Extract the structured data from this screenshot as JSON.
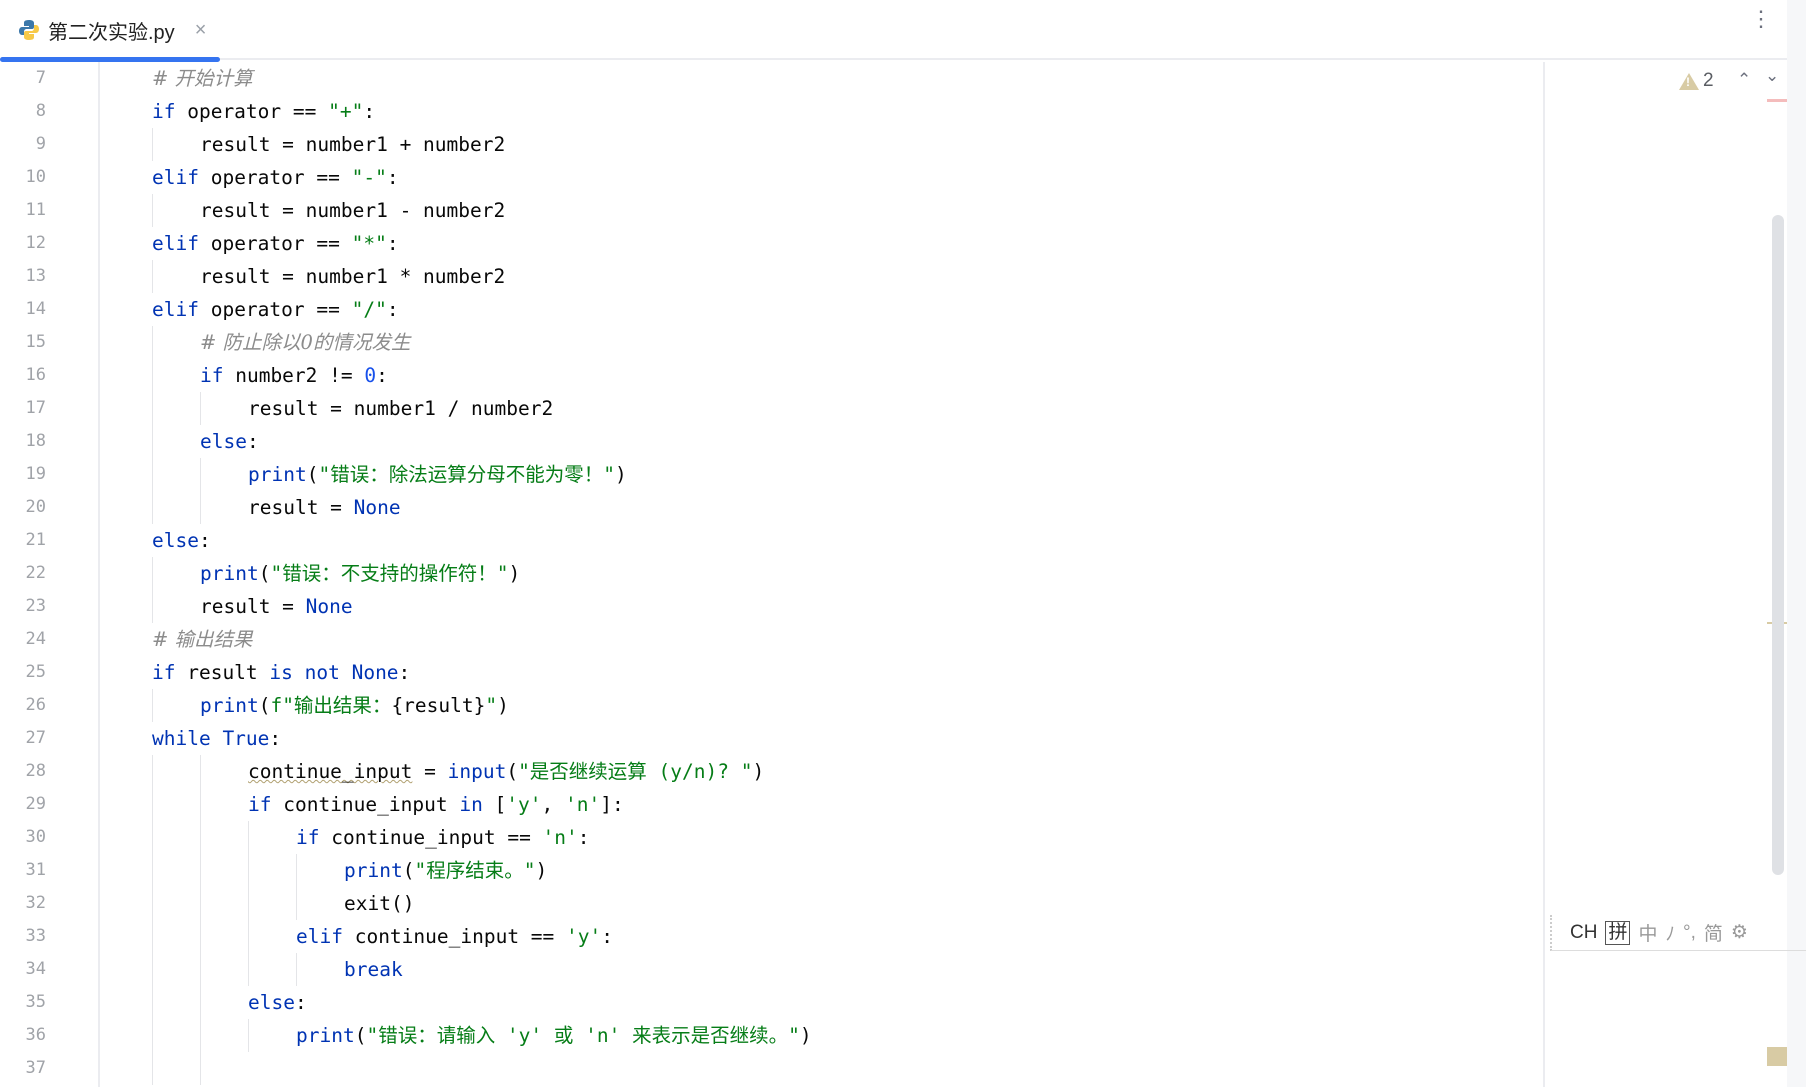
{
  "tab": {
    "title": "第二次实验.py",
    "close": "×"
  },
  "toolbar": {
    "more": "⋮"
  },
  "inspection": {
    "warning_count": "2",
    "up": "⌃",
    "down": "⌄"
  },
  "ime": {
    "items": [
      "CH",
      "拼",
      "中",
      "ﾉ",
      "°,",
      "简",
      "⚙"
    ]
  },
  "colors": {
    "accent": "#3574f0",
    "keyword": "#0033b3",
    "string": "#067d17",
    "comment": "#8c8c8c",
    "number": "#1750eb"
  },
  "lines": [
    {
      "n": "7",
      "indent": 0,
      "tokens": [
        [
          "# 开始计算",
          "cm"
        ]
      ]
    },
    {
      "n": "8",
      "indent": 0,
      "tokens": [
        [
          "if",
          "kw"
        ],
        [
          " operator == ",
          ""
        ],
        [
          "\"+\"",
          "str"
        ],
        [
          ":",
          ""
        ]
      ]
    },
    {
      "n": "9",
      "indent": 1,
      "tokens": [
        [
          "result = number1 + number2",
          ""
        ]
      ]
    },
    {
      "n": "10",
      "indent": 0,
      "tokens": [
        [
          "elif",
          "kw"
        ],
        [
          " operator == ",
          ""
        ],
        [
          "\"-\"",
          "str"
        ],
        [
          ":",
          ""
        ]
      ]
    },
    {
      "n": "11",
      "indent": 1,
      "tokens": [
        [
          "result = number1 - number2",
          ""
        ]
      ]
    },
    {
      "n": "12",
      "indent": 0,
      "tokens": [
        [
          "elif",
          "kw"
        ],
        [
          " operator == ",
          ""
        ],
        [
          "\"*\"",
          "str"
        ],
        [
          ":",
          ""
        ]
      ]
    },
    {
      "n": "13",
      "indent": 1,
      "tokens": [
        [
          "result = number1 * number2",
          ""
        ]
      ]
    },
    {
      "n": "14",
      "indent": 0,
      "tokens": [
        [
          "elif",
          "kw"
        ],
        [
          " operator == ",
          ""
        ],
        [
          "\"/\"",
          "str"
        ],
        [
          ":",
          ""
        ]
      ]
    },
    {
      "n": "15",
      "indent": 1,
      "tokens": [
        [
          "# 防止除以0的情况发生",
          "cm"
        ]
      ]
    },
    {
      "n": "16",
      "indent": 1,
      "tokens": [
        [
          "if",
          "kw"
        ],
        [
          " number2 != ",
          ""
        ],
        [
          "0",
          "num"
        ],
        [
          ":",
          ""
        ]
      ]
    },
    {
      "n": "17",
      "indent": 2,
      "tokens": [
        [
          "result = number1 / number2",
          ""
        ]
      ]
    },
    {
      "n": "18",
      "indent": 1,
      "tokens": [
        [
          "else",
          "kw"
        ],
        [
          ":",
          ""
        ]
      ]
    },
    {
      "n": "19",
      "indent": 2,
      "tokens": [
        [
          "print",
          "kw"
        ],
        [
          "(",
          ""
        ],
        [
          "\"错误：除法运算分母不能为零！\"",
          "str"
        ],
        [
          ")",
          ""
        ]
      ]
    },
    {
      "n": "20",
      "indent": 2,
      "tokens": [
        [
          "result = ",
          ""
        ],
        [
          "None",
          "kw"
        ]
      ]
    },
    {
      "n": "21",
      "indent": 0,
      "tokens": [
        [
          "else",
          "kw"
        ],
        [
          ":",
          ""
        ]
      ]
    },
    {
      "n": "22",
      "indent": 1,
      "tokens": [
        [
          "print",
          "kw"
        ],
        [
          "(",
          ""
        ],
        [
          "\"错误：不支持的操作符！\"",
          "str"
        ],
        [
          ")",
          ""
        ]
      ]
    },
    {
      "n": "23",
      "indent": 1,
      "tokens": [
        [
          "result = ",
          ""
        ],
        [
          "None",
          "kw"
        ]
      ]
    },
    {
      "n": "24",
      "indent": 0,
      "tokens": [
        [
          "# 输出结果",
          "cm"
        ]
      ]
    },
    {
      "n": "25",
      "indent": 0,
      "tokens": [
        [
          "if",
          "kw"
        ],
        [
          " result ",
          ""
        ],
        [
          "is not None",
          "kw"
        ],
        [
          ":",
          ""
        ]
      ]
    },
    {
      "n": "26",
      "indent": 1,
      "tokens": [
        [
          "print",
          "kw"
        ],
        [
          "(",
          ""
        ],
        [
          "f\"输出结果：",
          "str"
        ],
        [
          "{result}",
          ""
        ],
        [
          "\"",
          "str"
        ],
        [
          ")",
          ""
        ]
      ]
    },
    {
      "n": "27",
      "indent": 0,
      "tokens": [
        [
          "while True",
          "kw"
        ],
        [
          ":",
          ""
        ]
      ]
    },
    {
      "n": "28",
      "indent": 2,
      "tokens": [
        [
          "continue_input",
          "wav"
        ],
        [
          " = ",
          ""
        ],
        [
          "input",
          "kw"
        ],
        [
          "(",
          ""
        ],
        [
          "\"是否继续运算 (y/n)? \"",
          "str"
        ],
        [
          ")",
          ""
        ]
      ]
    },
    {
      "n": "29",
      "indent": 2,
      "tokens": [
        [
          "if",
          "kw"
        ],
        [
          " continue_input ",
          ""
        ],
        [
          "in",
          "kw"
        ],
        [
          " [",
          ""
        ],
        [
          "'y'",
          "str"
        ],
        [
          ", ",
          ""
        ],
        [
          "'n'",
          "str"
        ],
        [
          "]:",
          ""
        ]
      ]
    },
    {
      "n": "30",
      "indent": 3,
      "tokens": [
        [
          "if",
          "kw"
        ],
        [
          " continue_input == ",
          ""
        ],
        [
          "'n'",
          "str"
        ],
        [
          ":",
          ""
        ]
      ]
    },
    {
      "n": "31",
      "indent": 4,
      "tokens": [
        [
          "print",
          "kw"
        ],
        [
          "(",
          ""
        ],
        [
          "\"程序结束。\"",
          "str"
        ],
        [
          ")",
          ""
        ]
      ]
    },
    {
      "n": "32",
      "indent": 4,
      "tokens": [
        [
          "exit",
          ""
        ],
        [
          "()",
          ""
        ]
      ]
    },
    {
      "n": "33",
      "indent": 3,
      "tokens": [
        [
          "elif",
          "kw"
        ],
        [
          " continue_input == ",
          ""
        ],
        [
          "'y'",
          "str"
        ],
        [
          ":",
          ""
        ]
      ]
    },
    {
      "n": "34",
      "indent": 4,
      "tokens": [
        [
          "break",
          "kw"
        ]
      ]
    },
    {
      "n": "35",
      "indent": 2,
      "tokens": [
        [
          "else",
          "kw"
        ],
        [
          ":",
          ""
        ]
      ]
    },
    {
      "n": "36",
      "indent": 3,
      "tokens": [
        [
          "print",
          "kw"
        ],
        [
          "(",
          ""
        ],
        [
          "\"错误：请输入 'y' 或 'n' 来表示是否继续。\"",
          "str"
        ],
        [
          ")",
          ""
        ]
      ]
    },
    {
      "n": "37",
      "indent": 2,
      "tokens": []
    }
  ]
}
